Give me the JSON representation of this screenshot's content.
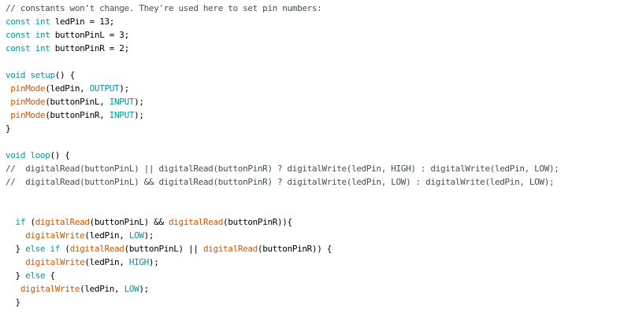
{
  "editor": {
    "lines": [
      [
        {
          "t": "// constants won't change. They're used here to set pin numbers:",
          "c": "cmt"
        }
      ],
      [
        {
          "t": "const",
          "c": "kw"
        },
        {
          "t": " "
        },
        {
          "t": "int",
          "c": "kw"
        },
        {
          "t": " ledPin = 13;"
        }
      ],
      [
        {
          "t": "const",
          "c": "kw"
        },
        {
          "t": " "
        },
        {
          "t": "int",
          "c": "kw"
        },
        {
          "t": " buttonPinL = 3;"
        }
      ],
      [
        {
          "t": "const",
          "c": "kw"
        },
        {
          "t": " "
        },
        {
          "t": "int",
          "c": "kw"
        },
        {
          "t": " buttonPinR = 2;"
        }
      ],
      [],
      [
        {
          "t": "void",
          "c": "kw"
        },
        {
          "t": " "
        },
        {
          "t": "setup",
          "c": "kw"
        },
        {
          "t": "() {"
        }
      ],
      [
        {
          "t": " "
        },
        {
          "t": "pinMode",
          "c": "fn"
        },
        {
          "t": "(ledPin, "
        },
        {
          "t": "OUTPUT",
          "c": "kw"
        },
        {
          "t": ");"
        }
      ],
      [
        {
          "t": " "
        },
        {
          "t": "pinMode",
          "c": "fn"
        },
        {
          "t": "(buttonPinL, "
        },
        {
          "t": "INPUT",
          "c": "kw"
        },
        {
          "t": ");"
        }
      ],
      [
        {
          "t": " "
        },
        {
          "t": "pinMode",
          "c": "fn"
        },
        {
          "t": "(buttonPinR, "
        },
        {
          "t": "INPUT",
          "c": "kw"
        },
        {
          "t": ");"
        }
      ],
      [
        {
          "t": "}"
        }
      ],
      [],
      [
        {
          "t": "void",
          "c": "kw"
        },
        {
          "t": " "
        },
        {
          "t": "loop",
          "c": "kw"
        },
        {
          "t": "() {"
        }
      ],
      [
        {
          "t": "//  digitalRead(buttonPinL) || digitalRead(buttonPinR) ? digitalWrite(ledPin, HIGH) : digitalWrite(ledPin, LOW);",
          "c": "cmt"
        }
      ],
      [
        {
          "t": "//  digitalRead(buttonPinL) && digitalRead(buttonPinR) ? digitalWrite(ledPin, LOW) : digitalWrite(ledPin, LOW);",
          "c": "cmt"
        }
      ],
      [],
      [],
      [
        {
          "t": "  "
        },
        {
          "t": "if",
          "c": "kw"
        },
        {
          "t": " ("
        },
        {
          "t": "digitalRead",
          "c": "fn"
        },
        {
          "t": "(buttonPinL) && "
        },
        {
          "t": "digitalRead",
          "c": "fn"
        },
        {
          "t": "(buttonPinR)){"
        }
      ],
      [
        {
          "t": "    "
        },
        {
          "t": "digitalWrite",
          "c": "fn"
        },
        {
          "t": "(ledPin, "
        },
        {
          "t": "LOW",
          "c": "kw"
        },
        {
          "t": ");"
        }
      ],
      [
        {
          "t": "  } "
        },
        {
          "t": "else",
          "c": "kw"
        },
        {
          "t": " "
        },
        {
          "t": "if",
          "c": "kw"
        },
        {
          "t": " ("
        },
        {
          "t": "digitalRead",
          "c": "fn"
        },
        {
          "t": "(buttonPinL) || "
        },
        {
          "t": "digitalRead",
          "c": "fn"
        },
        {
          "t": "(buttonPinR)) {"
        }
      ],
      [
        {
          "t": "    "
        },
        {
          "t": "digitalWrite",
          "c": "fn"
        },
        {
          "t": "(ledPin, "
        },
        {
          "t": "HIGH",
          "c": "kw"
        },
        {
          "t": ");"
        }
      ],
      [
        {
          "t": "  } "
        },
        {
          "t": "else",
          "c": "kw"
        },
        {
          "t": " {"
        }
      ],
      [
        {
          "t": "   "
        },
        {
          "t": "digitalWrite",
          "c": "fn"
        },
        {
          "t": "(ledPin, "
        },
        {
          "t": "LOW",
          "c": "kw"
        },
        {
          "t": ");"
        }
      ],
      [
        {
          "t": "  }"
        }
      ]
    ]
  },
  "colors": {
    "background": "#ffffff",
    "keyword": "#00979c",
    "function": "#d35400",
    "comment": "#434f54",
    "text": "#000000"
  }
}
